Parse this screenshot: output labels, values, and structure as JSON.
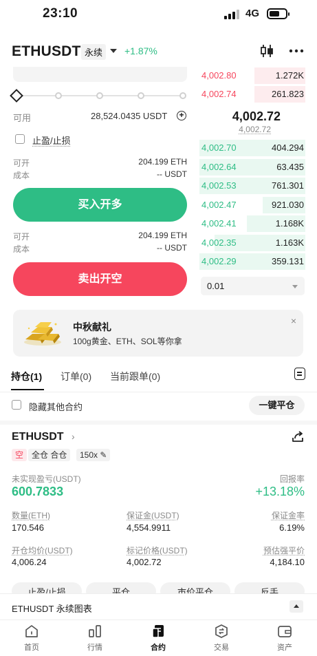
{
  "status_bar": {
    "time": "23:10",
    "network": "4G"
  },
  "header": {
    "symbol": "ETHUSDT",
    "contract_type": "永续",
    "change": "+1.87%"
  },
  "order_form": {
    "available_label": "可用",
    "available_value": "28,524.0435 USDT",
    "tpsl_label": "止盈/止损",
    "buy": {
      "open_label": "可开",
      "open_value": "204.199 ETH",
      "cost_label": "成本",
      "cost_value": "-- USDT",
      "button": "买入开多"
    },
    "sell": {
      "open_label": "可开",
      "open_value": "204.199 ETH",
      "cost_label": "成本",
      "cost_value": "-- USDT",
      "button": "卖出开空"
    }
  },
  "order_book": {
    "asks": [
      {
        "price": "4,002.80",
        "qty": "1.272K",
        "depth": 0.48
      },
      {
        "price": "4,002.74",
        "qty": "261.823",
        "depth": 0.48
      }
    ],
    "last_price": "4,002.72",
    "mark_price": "4,002.72",
    "bids": [
      {
        "price": "4,002.70",
        "qty": "404.294",
        "depth": 1.0
      },
      {
        "price": "4,002.64",
        "qty": "63.435",
        "depth": 1.0
      },
      {
        "price": "4,002.53",
        "qty": "761.301",
        "depth": 1.0
      },
      {
        "price": "4,002.47",
        "qty": "921.030",
        "depth": 0.4
      },
      {
        "price": "4,002.41",
        "qty": "1.168K",
        "depth": 0.55
      },
      {
        "price": "4,002.35",
        "qty": "1.163K",
        "depth": 0.86
      },
      {
        "price": "4,002.29",
        "qty": "359.131",
        "depth": 1.0
      }
    ],
    "precision": "0.01"
  },
  "banner": {
    "title": "中秋献礼",
    "subtitle": "100g黄金、ETH、SOL等你拿"
  },
  "tabs": [
    {
      "label": "持仓(1)",
      "active": true
    },
    {
      "label": "订单(0)",
      "active": false
    },
    {
      "label": "当前跟单(0)",
      "active": false
    }
  ],
  "filters": {
    "hide_others": "隐藏其他合约",
    "close_all": "一键平仓"
  },
  "position": {
    "symbol": "ETHUSDT",
    "side": "空",
    "margin_mode": "全仓 合仓",
    "leverage": "150x",
    "upnl_label": "未实现盈亏(USDT)",
    "upnl_value": "600.7833",
    "roe_label": "回报率",
    "roe_value": "+13.18%",
    "size_label": "数量(ETH)",
    "size_value": "170.546",
    "margin_label": "保证金(USDT)",
    "margin_value": "4,554.9911",
    "margin_ratio_label": "保证金率",
    "margin_ratio_value": "6.19%",
    "entry_label": "开仓均价(USDT)",
    "entry_value": "4,006.24",
    "mark_label": "标记价格(USDT)",
    "mark_value": "4,002.72",
    "liq_label": "预估强平价",
    "liq_value": "4,184.10",
    "actions": [
      "止盈/止损",
      "平仓",
      "市价平仓",
      "反手"
    ]
  },
  "chart_bar": {
    "title": "ETHUSDT 永续图表"
  },
  "nav": [
    {
      "label": "首页",
      "icon": "home-icon",
      "active": false
    },
    {
      "label": "行情",
      "icon": "market-icon",
      "active": false
    },
    {
      "label": "合约",
      "icon": "futures-icon",
      "active": true
    },
    {
      "label": "交易",
      "icon": "trade-icon",
      "active": false
    },
    {
      "label": "资产",
      "icon": "wallet-icon",
      "active": false
    }
  ],
  "colors": {
    "green": "#2ebd85",
    "red": "#f6465d",
    "bid_bg": "#e9f8f1",
    "ask_bg": "#fdecee"
  }
}
